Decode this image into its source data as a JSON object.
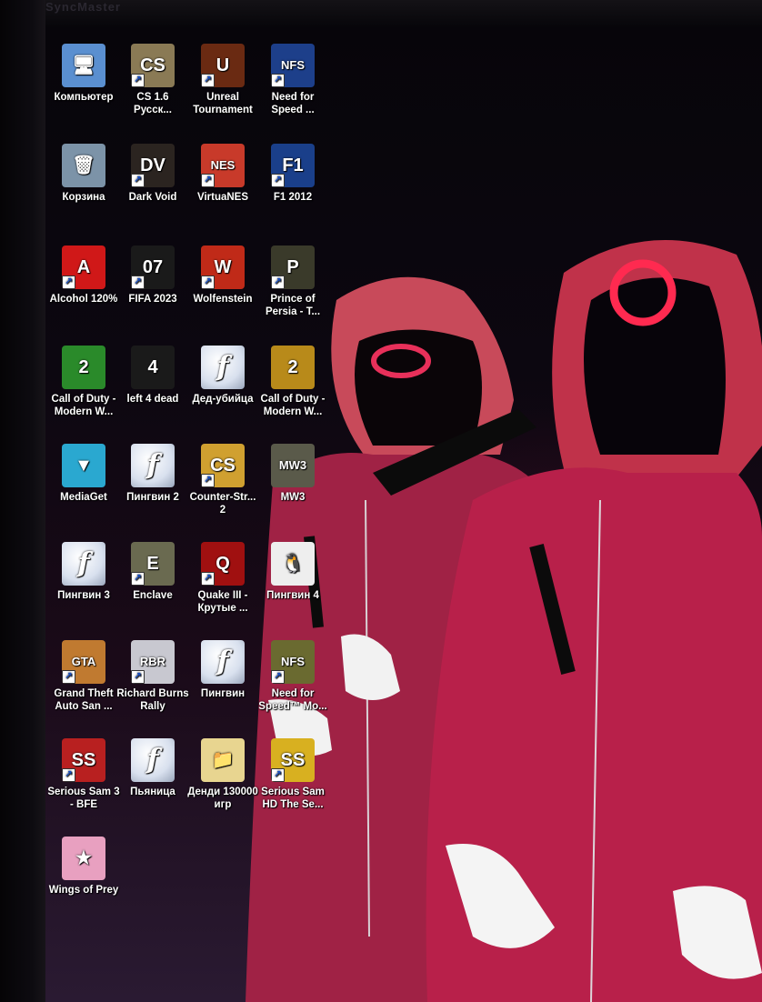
{
  "desktop": {
    "brand_text": "SyncMaster",
    "icons": [
      {
        "label": "Компьютер",
        "icon": "computer-icon",
        "shortcut": false,
        "color": "#5a8fd0",
        "glyph": "🖥"
      },
      {
        "label": "CS 1.6 Русск...",
        "icon": "cs-icon",
        "shortcut": true,
        "color": "#8a7a55",
        "glyph": "CS"
      },
      {
        "label": "Unreal Tournament",
        "icon": "unreal-icon",
        "shortcut": true,
        "color": "#6a2a12",
        "glyph": "U"
      },
      {
        "label": "Need for Speed ...",
        "icon": "nfs-icon",
        "shortcut": true,
        "color": "#1d3f8a",
        "glyph": "NFS"
      },
      {
        "label": "Корзина",
        "icon": "recycle-bin-icon",
        "shortcut": false,
        "color": "#7c93a8",
        "glyph": "🗑"
      },
      {
        "label": "Dark Void",
        "icon": "darkvoid-icon",
        "shortcut": true,
        "color": "#2b2420",
        "glyph": "DV"
      },
      {
        "label": "VirtuaNES",
        "icon": "virtuanes-icon",
        "shortcut": true,
        "color": "#c83a2a",
        "glyph": "NES"
      },
      {
        "label": "F1 2012",
        "icon": "f1-icon",
        "shortcut": true,
        "color": "#1a3f8a",
        "glyph": "F1"
      },
      {
        "label": "Alcohol 120%",
        "icon": "alcohol-icon",
        "shortcut": true,
        "color": "#d01818",
        "glyph": "A"
      },
      {
        "label": "FIFA 2023",
        "icon": "fifa-icon",
        "shortcut": true,
        "color": "#1a1a1a",
        "glyph": "07"
      },
      {
        "label": "Wolfenstein",
        "icon": "wolfenstein-icon",
        "shortcut": true,
        "color": "#c02a18",
        "glyph": "W"
      },
      {
        "label": "Prince of Persia - T...",
        "icon": "prince-icon",
        "shortcut": true,
        "color": "#3a3a2a",
        "glyph": "P"
      },
      {
        "label": "Call of Duty - Modern W...",
        "icon": "cod-icon",
        "shortcut": false,
        "color": "#2a8a2a",
        "glyph": "2"
      },
      {
        "label": "left 4 dead",
        "icon": "l4d-icon",
        "shortcut": false,
        "color": "#1a1a1a",
        "glyph": "4"
      },
      {
        "label": "Дед-убийца",
        "icon": "flash-icon",
        "shortcut": false,
        "color": "#ffffff",
        "glyph": "f"
      },
      {
        "label": "Call of Duty - Modern W...",
        "icon": "cod-icon",
        "shortcut": false,
        "color": "#b88a1a",
        "glyph": "2"
      },
      {
        "label": "MediaGet",
        "icon": "mediaget-icon",
        "shortcut": false,
        "color": "#2aa8d0",
        "glyph": "▼"
      },
      {
        "label": "Пингвин 2",
        "icon": "flash-icon",
        "shortcut": false,
        "color": "#ffffff",
        "glyph": "f"
      },
      {
        "label": "Counter-Str... 2",
        "icon": "cs2-icon",
        "shortcut": true,
        "color": "#d0a030",
        "glyph": "CS"
      },
      {
        "label": "MW3",
        "icon": "mw3-icon",
        "shortcut": false,
        "color": "#5a5a4a",
        "glyph": "MW3"
      },
      {
        "label": "Пингвин 3",
        "icon": "flash-icon",
        "shortcut": false,
        "color": "#ffffff",
        "glyph": "f"
      },
      {
        "label": "Enclave",
        "icon": "enclave-icon",
        "shortcut": true,
        "color": "#6a6a50",
        "glyph": "E"
      },
      {
        "label": "Quake III - Крутые ...",
        "icon": "quake-icon",
        "shortcut": true,
        "color": "#a01010",
        "glyph": "Q"
      },
      {
        "label": "Пингвин 4",
        "icon": "penguin-icon",
        "shortcut": false,
        "color": "#eeeeee",
        "glyph": "🐧"
      },
      {
        "label": "Grand Theft Auto San ...",
        "icon": "gta-icon",
        "shortcut": true,
        "color": "#c07a30",
        "glyph": "GTA"
      },
      {
        "label": "Richard Burns Rally",
        "icon": "rbr-icon",
        "shortcut": true,
        "color": "#c8c8d0",
        "glyph": "RBR"
      },
      {
        "label": "Пингвин",
        "icon": "flash-icon",
        "shortcut": false,
        "color": "#ffffff",
        "glyph": "f"
      },
      {
        "label": "Need for Speed™ Mo...",
        "icon": "nfsmw-icon",
        "shortcut": true,
        "color": "#6a6a30",
        "glyph": "NFS"
      },
      {
        "label": "Serious Sam 3 - BFE",
        "icon": "serioussam-icon",
        "shortcut": true,
        "color": "#b82020",
        "glyph": "SS"
      },
      {
        "label": "Пьяница",
        "icon": "flash-icon",
        "shortcut": false,
        "color": "#ffffff",
        "glyph": "f"
      },
      {
        "label": "Денди 130000 игр",
        "icon": "folder-icon",
        "shortcut": false,
        "color": "#e8d590",
        "glyph": "📁"
      },
      {
        "label": "Serious Sam HD The Se...",
        "icon": "serioussam-hd-icon",
        "shortcut": true,
        "color": "#d8b020",
        "glyph": "SS"
      },
      {
        "label": "Wings of Prey",
        "icon": "wingsofprey-icon",
        "shortcut": false,
        "color": "#e8a0c0",
        "glyph": "★"
      }
    ]
  }
}
